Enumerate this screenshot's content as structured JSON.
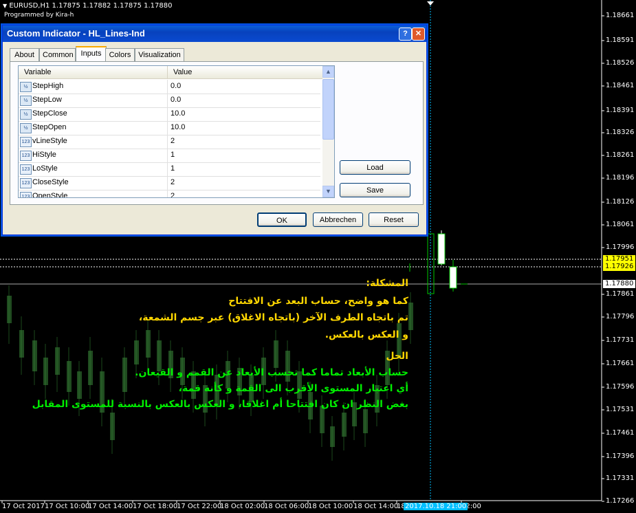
{
  "chart": {
    "symbol_line": "EURUSD,H1  1.17875 1.17882 1.17875 1.17880",
    "programmed_by": "Programmed by Kira-h",
    "price_labels": [
      "1.18661",
      "1.18591",
      "1.18526",
      "1.18461",
      "1.18391",
      "1.18326",
      "1.18261",
      "1.18196",
      "1.18126",
      "1.18061",
      "1.17996",
      "1.17861",
      "1.17796",
      "1.17731",
      "1.17661",
      "1.17596",
      "1.17531",
      "1.17461",
      "1.17396",
      "1.17331",
      "1.17266"
    ],
    "price_tags": {
      "line1": "1.17951",
      "line2": "1.17926",
      "current": "1.17880"
    },
    "time_labels": [
      "17 Oct 2017",
      "17 Oct 10:00",
      "17 Oct 14:00",
      "17 Oct 18:00",
      "17 Oct 22:00",
      "18 Oct 02:00",
      "18 Oct 06:00",
      "18 Oct 10:00",
      "18 Oct 14:00",
      "18 Oct 18:00",
      "22:00"
    ],
    "cursor_time": "2017.10.18 21:00",
    "colors": {
      "bull": "#ffffff",
      "bear": "#00c800",
      "highlight_time": "#00bfff",
      "tag_bg": "#ffff00"
    }
  },
  "annotation": {
    "problem_title": "المشكلة:",
    "problem_line1": "كما هو واضح، حساب البعد عن الافتتاح",
    "problem_line2": "تم باتجاه الطرف الآخر (باتجاه الاغلاق) عبر جسم الشمعة،",
    "problem_line3": "و العكس بالعكس.",
    "solution_title": "الحل",
    "solution_line1": "حساب الأبعاد تماما كما تحسب الأبعاد عن القمم و القيعان.",
    "solution_line2": "أي اعتبار المستوى الأقرب الى القمة و كأنه قمة،",
    "solution_line3": "بغض النظر ان كان افتتاحا أم اغلاقا، و العكس بالعكس بالنسبة للمستوى المقابل"
  },
  "dialog": {
    "title": "Custom Indicator - HL_Lines-Ind",
    "help_btn": "?",
    "close_btn": "✕",
    "tabs": [
      "About",
      "Common",
      "Inputs",
      "Colors",
      "Visualization"
    ],
    "active_tab": "Inputs",
    "grid": {
      "col_variable": "Variable",
      "col_value": "Value",
      "rows": [
        {
          "icon": "½",
          "name": "StepHigh",
          "value": "0.0"
        },
        {
          "icon": "½",
          "name": "StepLow",
          "value": "0.0"
        },
        {
          "icon": "½",
          "name": "StepClose",
          "value": "10.0"
        },
        {
          "icon": "½",
          "name": "StepOpen",
          "value": "10.0"
        },
        {
          "icon": "123",
          "name": "vLineStyle",
          "value": "2"
        },
        {
          "icon": "123",
          "name": "HiStyle",
          "value": "1"
        },
        {
          "icon": "123",
          "name": "LoStyle",
          "value": "1"
        },
        {
          "icon": "123",
          "name": "CloseStyle",
          "value": "2"
        },
        {
          "icon": "123",
          "name": "OpenStyle",
          "value": "2"
        }
      ]
    },
    "load_label": "Load",
    "save_label": "Save",
    "ok_label": "OK",
    "cancel_label": "Abbrechen",
    "reset_label": "Reset"
  }
}
